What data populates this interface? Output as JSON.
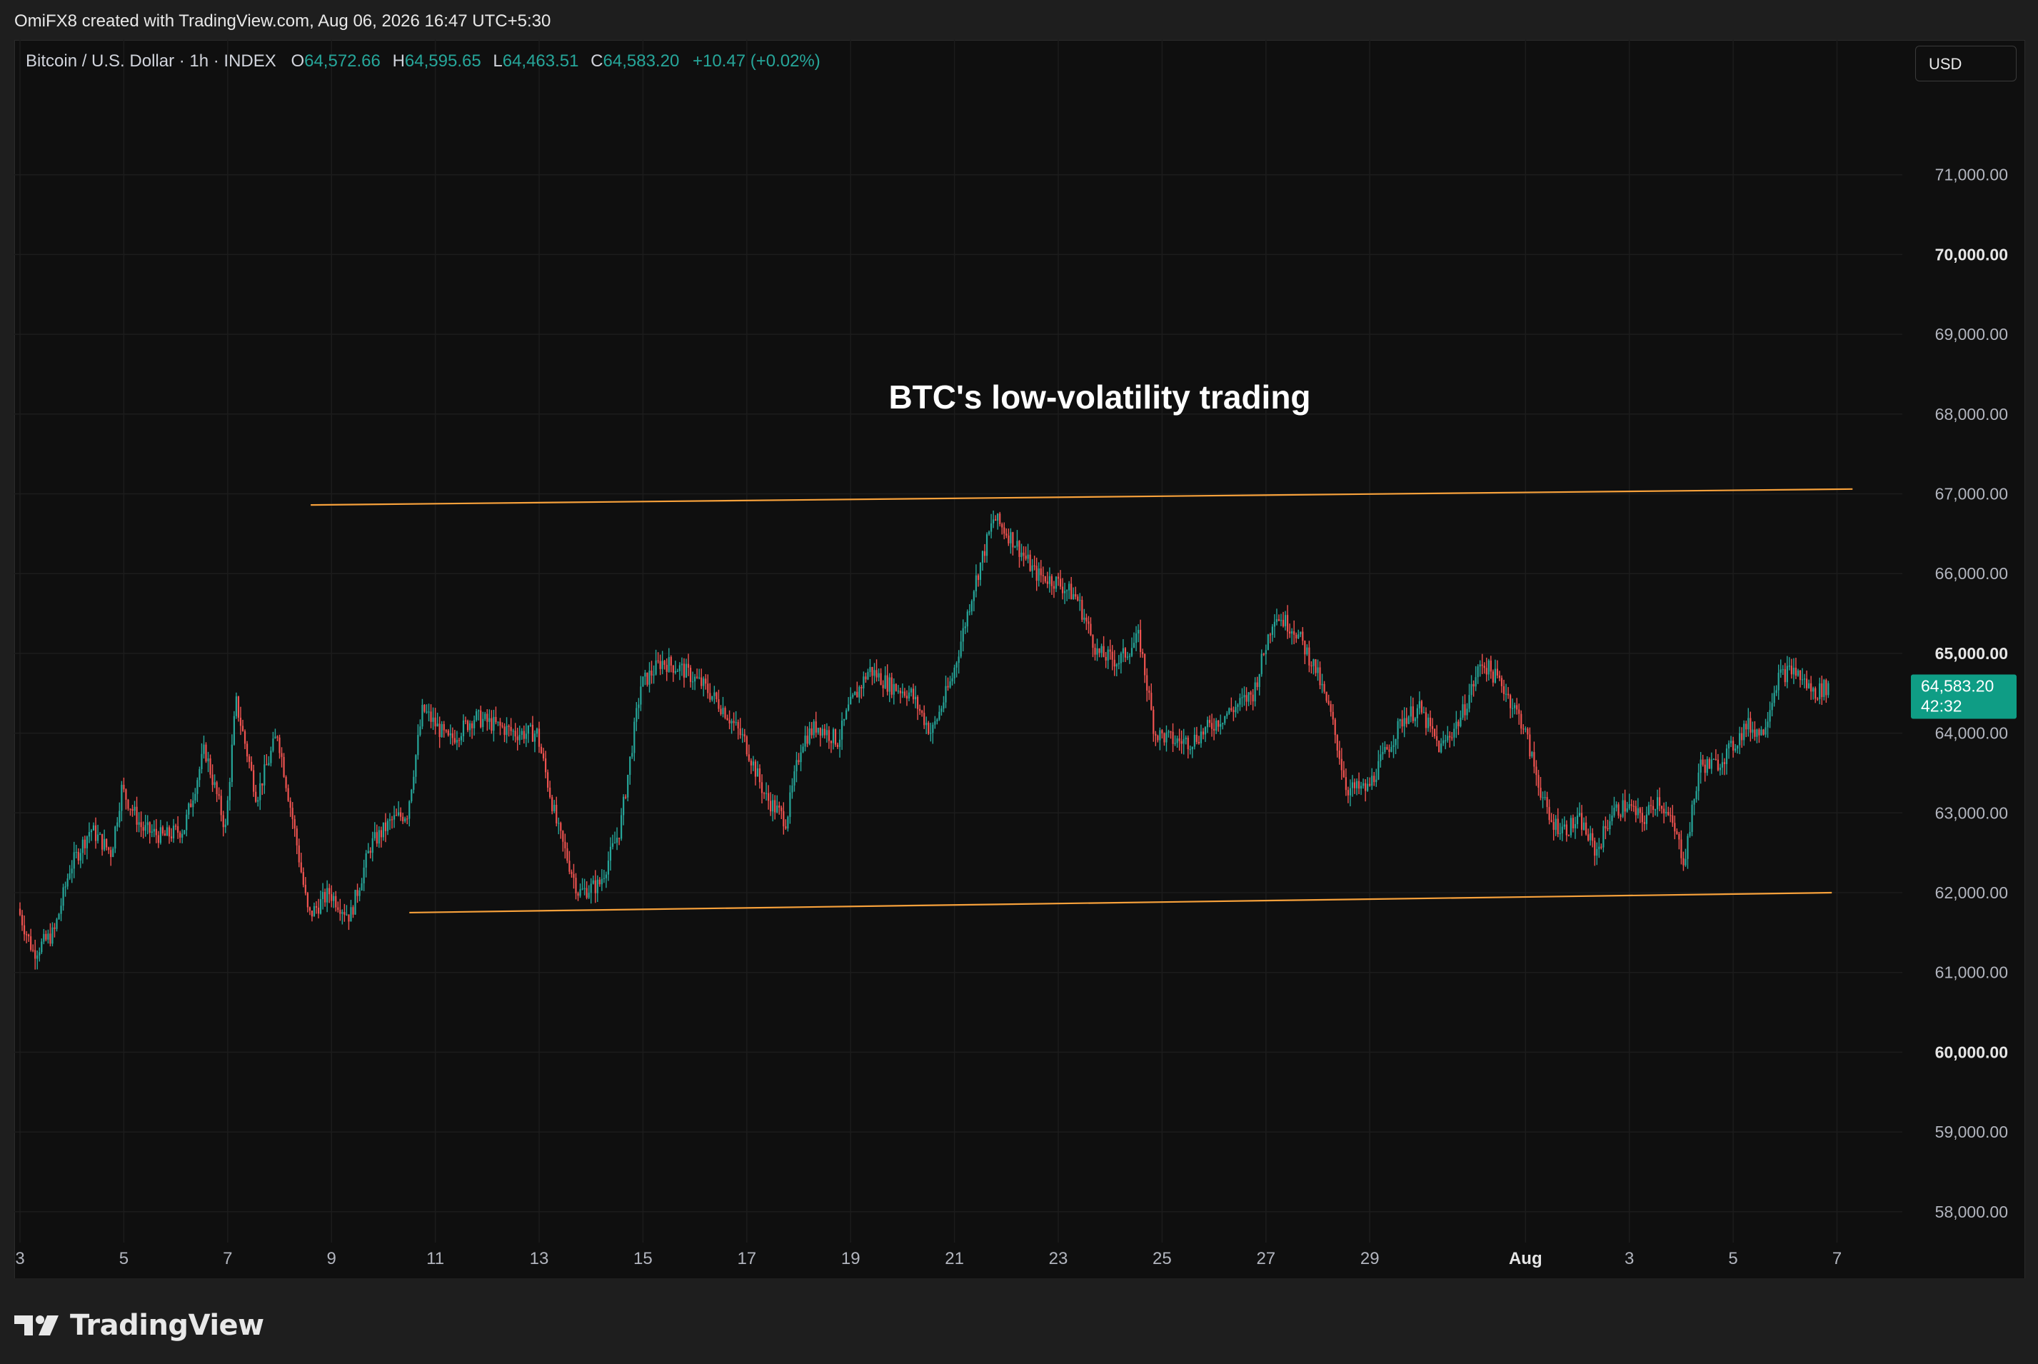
{
  "attribution": "OmiFX8 created with TradingView.com, Aug 06, 2026 16:47 UTC+5:30",
  "legend": {
    "symbol": "Bitcoin / U.S. Dollar · 1h · INDEX",
    "open_label": "O",
    "open": "64,572.66",
    "high_label": "H",
    "high": "64,595.65",
    "low_label": "L",
    "low": "64,463.51",
    "close_label": "C",
    "close": "64,583.20",
    "change": "+10.47 (+0.02%)"
  },
  "currency_button": "USD",
  "price_tag": {
    "price": "64,583.20",
    "countdown": "42:32"
  },
  "annotation": "BTC's low-volatility trading",
  "footer": {
    "brand": "TradingView"
  },
  "colors": {
    "up": "#26a69a",
    "down": "#ef5350",
    "trendline": "#f7a13b",
    "background": "#0f0f0f",
    "grid": "#1c1c1c",
    "price_tag": "#0f9d85"
  },
  "chart_data": {
    "type": "candlestick",
    "title": "",
    "ylim": [
      57300,
      72000
    ],
    "y_ticks": [
      {
        "value": 71000,
        "label": "71,000.00",
        "bold": false
      },
      {
        "value": 70000,
        "label": "70,000.00",
        "bold": true
      },
      {
        "value": 69000,
        "label": "69,000.00",
        "bold": false
      },
      {
        "value": 68000,
        "label": "68,000.00",
        "bold": false
      },
      {
        "value": 67000,
        "label": "67,000.00",
        "bold": false
      },
      {
        "value": 66000,
        "label": "66,000.00",
        "bold": false
      },
      {
        "value": 65000,
        "label": "65,000.00",
        "bold": true
      },
      {
        "value": 64000,
        "label": "64,000.00",
        "bold": false
      },
      {
        "value": 63000,
        "label": "63,000.00",
        "bold": false
      },
      {
        "value": 62000,
        "label": "62,000.00",
        "bold": false
      },
      {
        "value": 61000,
        "label": "61,000.00",
        "bold": false
      },
      {
        "value": 60000,
        "label": "60,000.00",
        "bold": true
      },
      {
        "value": 59000,
        "label": "59,000.00",
        "bold": false
      },
      {
        "value": 58000,
        "label": "58,000.00",
        "bold": false
      }
    ],
    "x_ticks": [
      {
        "day": 3,
        "label": "3",
        "bold": false
      },
      {
        "day": 5,
        "label": "5",
        "bold": false
      },
      {
        "day": 7,
        "label": "7",
        "bold": false
      },
      {
        "day": 9,
        "label": "9",
        "bold": false
      },
      {
        "day": 11,
        "label": "11",
        "bold": false
      },
      {
        "day": 13,
        "label": "13",
        "bold": false
      },
      {
        "day": 15,
        "label": "15",
        "bold": false
      },
      {
        "day": 17,
        "label": "17",
        "bold": false
      },
      {
        "day": 19,
        "label": "19",
        "bold": false
      },
      {
        "day": 21,
        "label": "21",
        "bold": false
      },
      {
        "day": 23,
        "label": "23",
        "bold": false
      },
      {
        "day": 25,
        "label": "25",
        "bold": false
      },
      {
        "day": 27,
        "label": "27",
        "bold": false
      },
      {
        "day": 29,
        "label": "29",
        "bold": false
      },
      {
        "day": 32,
        "label": "Aug",
        "bold": true
      },
      {
        "day": 34,
        "label": "3",
        "bold": false
      },
      {
        "day": 36,
        "label": "5",
        "bold": false
      },
      {
        "day": 38,
        "label": "7",
        "bold": false
      }
    ],
    "xlim": [
      3,
      39
    ],
    "price_path": [
      [
        3.0,
        61800
      ],
      [
        3.3,
        61250
      ],
      [
        3.7,
        61500
      ],
      [
        4.0,
        62300
      ],
      [
        4.4,
        62800
      ],
      [
        4.8,
        62500
      ],
      [
        5.0,
        63300
      ],
      [
        5.4,
        62800
      ],
      [
        5.8,
        62700
      ],
      [
        6.2,
        62800
      ],
      [
        6.6,
        63800
      ],
      [
        7.0,
        62800
      ],
      [
        7.2,
        64400
      ],
      [
        7.6,
        63200
      ],
      [
        8.0,
        64000
      ],
      [
        8.3,
        62900
      ],
      [
        8.6,
        61700
      ],
      [
        9.0,
        62000
      ],
      [
        9.4,
        61700
      ],
      [
        9.8,
        62600
      ],
      [
        10.2,
        62900
      ],
      [
        10.5,
        63000
      ],
      [
        10.8,
        64300
      ],
      [
        11.3,
        63900
      ],
      [
        11.8,
        64200
      ],
      [
        12.2,
        64100
      ],
      [
        12.6,
        64000
      ],
      [
        13.0,
        64000
      ],
      [
        13.4,
        62800
      ],
      [
        13.8,
        62000
      ],
      [
        14.2,
        62100
      ],
      [
        14.6,
        62800
      ],
      [
        15.0,
        64600
      ],
      [
        15.4,
        64900
      ],
      [
        15.8,
        64800
      ],
      [
        16.2,
        64600
      ],
      [
        16.6,
        64300
      ],
      [
        17.0,
        63900
      ],
      [
        17.4,
        63200
      ],
      [
        17.8,
        62900
      ],
      [
        18.1,
        63900
      ],
      [
        18.4,
        64100
      ],
      [
        18.8,
        63900
      ],
      [
        19.0,
        64300
      ],
      [
        19.4,
        64800
      ],
      [
        19.8,
        64600
      ],
      [
        20.2,
        64500
      ],
      [
        20.6,
        64000
      ],
      [
        21.0,
        64700
      ],
      [
        21.4,
        65800
      ],
      [
        21.8,
        66700
      ],
      [
        22.2,
        66400
      ],
      [
        22.6,
        66000
      ],
      [
        23.0,
        65900
      ],
      [
        23.4,
        65700
      ],
      [
        23.8,
        65000
      ],
      [
        24.2,
        64900
      ],
      [
        24.6,
        65200
      ],
      [
        24.9,
        64000
      ],
      [
        25.3,
        63900
      ],
      [
        25.6,
        63900
      ],
      [
        26.0,
        64100
      ],
      [
        26.4,
        64300
      ],
      [
        26.8,
        64500
      ],
      [
        27.2,
        65500
      ],
      [
        27.6,
        65300
      ],
      [
        28.0,
        64800
      ],
      [
        28.3,
        64200
      ],
      [
        28.6,
        63300
      ],
      [
        29.0,
        63300
      ],
      [
        29.3,
        63700
      ],
      [
        29.7,
        64200
      ],
      [
        30.0,
        64300
      ],
      [
        30.4,
        63800
      ],
      [
        30.8,
        64200
      ],
      [
        31.2,
        64900
      ],
      [
        31.6,
        64600
      ],
      [
        32.0,
        64100
      ],
      [
        32.2,
        63600
      ],
      [
        32.5,
        62900
      ],
      [
        32.8,
        62800
      ],
      [
        33.1,
        62900
      ],
      [
        33.4,
        62500
      ],
      [
        33.7,
        63000
      ],
      [
        34.0,
        63100
      ],
      [
        34.3,
        62900
      ],
      [
        34.6,
        63200
      ],
      [
        34.9,
        62800
      ],
      [
        35.1,
        62400
      ],
      [
        35.4,
        63600
      ],
      [
        35.7,
        63600
      ],
      [
        36.0,
        63800
      ],
      [
        36.3,
        64100
      ],
      [
        36.6,
        64000
      ],
      [
        36.9,
        64700
      ],
      [
        37.2,
        64800
      ],
      [
        37.6,
        64500
      ],
      [
        37.85,
        64583
      ]
    ],
    "trendlines": [
      {
        "name": "upper",
        "from": [
          8.6,
          66860
        ],
        "to": [
          38.3,
          67060
        ]
      },
      {
        "name": "lower",
        "from": [
          10.5,
          61750
        ],
        "to": [
          37.9,
          62000
        ]
      }
    ],
    "last_price": 64583.2
  }
}
